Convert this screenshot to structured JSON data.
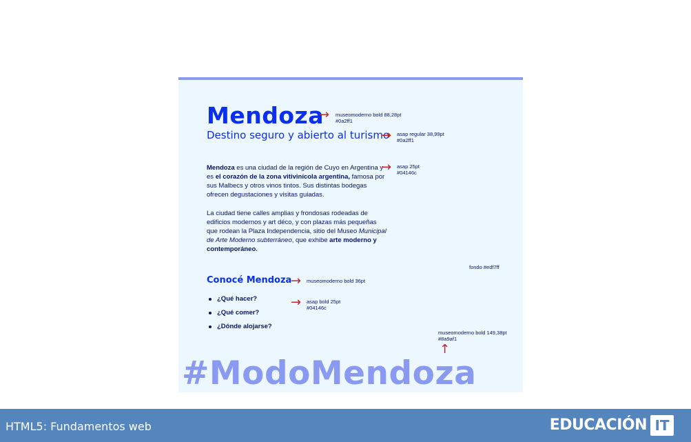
{
  "slide": {
    "background": "#edf7ff",
    "accent": "#8a9af1",
    "title": "Mendoza",
    "title_note": {
      "font": "museomoderno bold 88,28pt",
      "color": "#0a2ff1"
    },
    "subtitle": "Destino seguro y abierto al turismo",
    "subtitle_note": {
      "font": "asap regular 38,99pt",
      "color": "#0a2ff1"
    },
    "paragraph1": {
      "p1": "Mendoza",
      "p2": " es una ciudad de la región de Cuyo en Argentina y es ",
      "p3": "el corazón de la zona vitivinícola argentina,",
      "p4": " famosa por sus Malbecs y otros vinos tintos. Sus distintas bodegas ofrecen degustaciones y visitas guiadas."
    },
    "paragraph_note": {
      "font": "asap 25pt",
      "color": "#04146c"
    },
    "paragraph2": {
      "p1": "La ciudad tiene calles amplias y frondosas rodeadas de edificios modernos y art déco, y con plazas más pequeñas que rodean la Plaza Independencia, sitio del Museo ",
      "p2": "Municipal de Arte Moderno subterráneo",
      "p3": ", que exhibe ",
      "p4": "arte moderno y contemporáneo."
    },
    "background_note": "fondo #edf7ff",
    "section_title": "Conocé Mendoza",
    "section_note": "museomoderno bold 36pt",
    "list_items": [
      "¿Qué hacer?",
      "¿Qué comer?",
      "¿Dónde alojarse?"
    ],
    "list_note": {
      "font": "asap bold 25pt",
      "color": "#04146c"
    },
    "hashtag_note": {
      "font": "museomoderno bold 149,38pt",
      "color": "#8a9af1"
    },
    "hashtag": "#ModoMendoza",
    "arrows": {
      "right": "→",
      "up": "↑"
    }
  },
  "footer": {
    "background": "#5585bd",
    "course": "HTML5: Fundamentos web",
    "logo_text": "EDUCACIÓN",
    "logo_box": "IT"
  }
}
